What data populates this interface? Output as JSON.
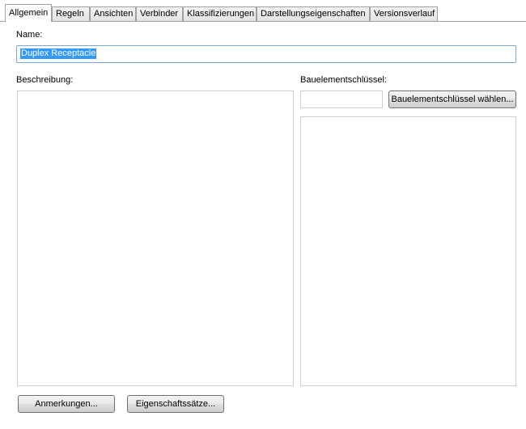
{
  "tabs": [
    {
      "label": "Allgemein",
      "active": true
    },
    {
      "label": "Regeln"
    },
    {
      "label": "Ansichten"
    },
    {
      "label": "Verbinder"
    },
    {
      "label": "Klassifizierungen"
    },
    {
      "label": "Darstellungseigenschaften"
    },
    {
      "label": "Versionsverlauf"
    }
  ],
  "general": {
    "name_label": "Name:",
    "name_value": "Duplex Receptacle",
    "description_label": "Beschreibung:",
    "description_value": "",
    "component_key_label": "Bauelementschlüssel:",
    "component_key_value": "",
    "component_key_button": "Bauelementschlüssel wählen..."
  },
  "footer": {
    "notes_button": "Anmerkungen...",
    "property_sets_button": "Eigenschaftssätze..."
  }
}
